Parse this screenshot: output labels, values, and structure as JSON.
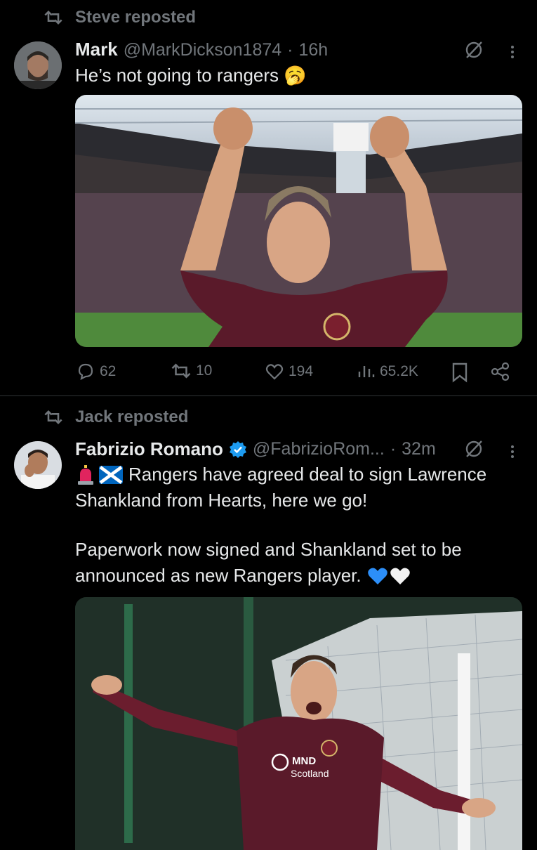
{
  "tweet1": {
    "repost_text": "Steve reposted",
    "name": "Mark",
    "handle": "@MarkDickson1874",
    "dot": "·",
    "time": "16h",
    "text": "He’s not going to rangers",
    "emoji": "🥱",
    "metrics": {
      "replies": "62",
      "reposts": "10",
      "likes": "194",
      "views": "65.2K"
    }
  },
  "tweet2": {
    "repost_text": "Jack reposted",
    "name": "Fabrizio Romano",
    "handle": "@FabrizioRom...",
    "dot": "·",
    "time": "32m",
    "text_line1": "Rangers have agreed deal to sign Lawrence",
    "text_line2": "Shankland from Hearts, here we go!",
    "text_line3": "Paperwork now signed and Shankland set to be",
    "text_line4": "announced as new Rangers player.",
    "shirt_sponsor_line1": "MND",
    "shirt_sponsor_line2": "Scotland"
  },
  "colors": {
    "background": "#000000",
    "text": "#e7e9ea",
    "secondary": "#71767b",
    "verified": "#1d9bf0",
    "shirt": "#5a1a2a"
  }
}
